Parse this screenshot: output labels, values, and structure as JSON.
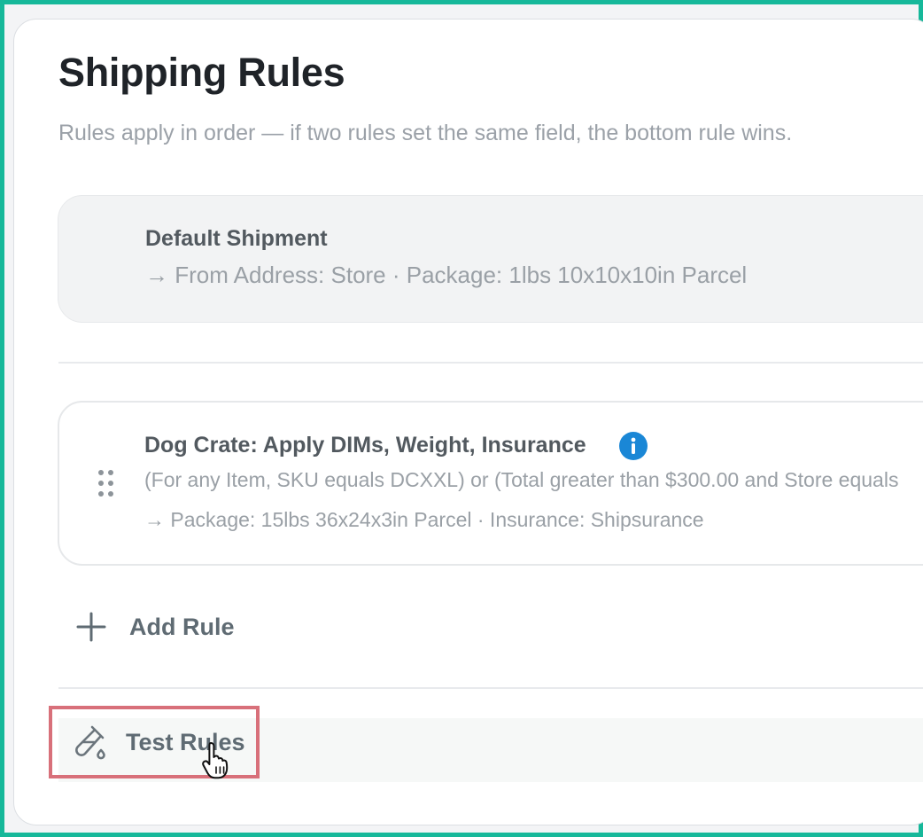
{
  "page": {
    "title": "Shipping Rules",
    "subtitle": "Rules apply in order — if two rules set the same field, the bottom rule wins."
  },
  "default_rule": {
    "name": "Default Shipment",
    "detail": "→ From Address: Store · Package: 1lbs 10x10x10in Parcel"
  },
  "rules": [
    {
      "name": "Dog Crate: Apply DIMs, Weight, Insurance",
      "condition": "(For any Item, SKU equals DCXXL) or (Total greater than $300.00 and Store equals",
      "action": "→ Package: 15lbs 36x24x3in Parcel · Insurance: Shipsurance"
    }
  ],
  "actions": {
    "add_rule_label": "Add Rule",
    "test_rules_label": "Test Rules"
  },
  "icons": {
    "info": "info-icon",
    "drag": "drag-handle-icon",
    "add": "plus-icon",
    "test": "test-tube-icon",
    "cursor": "hand-pointer-icon"
  },
  "colors": {
    "frame": "#16b89a",
    "info_blue": "#1a87d6",
    "highlight": "#d8707a",
    "text_muted": "#9aa0a6",
    "text_heading": "#1f2328"
  }
}
